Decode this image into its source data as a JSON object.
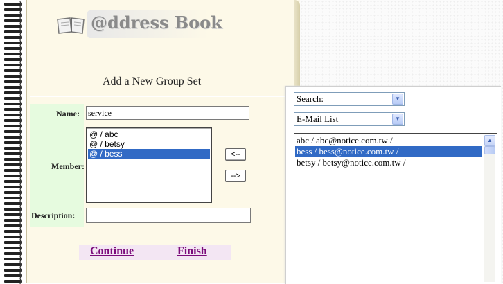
{
  "header": {
    "app_title": "@ddress Book",
    "icon": "book-icon"
  },
  "form": {
    "heading": "Add a New Group Set",
    "name_label": "Name:",
    "name_value": "service",
    "member_label": "Member:",
    "members": [
      "@ / abc",
      "@ / betsy",
      "@ / bess"
    ],
    "selected_member": "@ / bess",
    "remove_button": "<--",
    "add_button": "-->",
    "description_label": "Description:",
    "description_value": ""
  },
  "actions": {
    "continue_label": "Continue",
    "finish_label": "Finish"
  },
  "right_panel": {
    "search_select": "Search:",
    "list_select": "E-Mail List",
    "emails": [
      "abc / abc@notice.com.tw /",
      "bess / bess@notice.com.tw /",
      "betsy / betsy@notice.com.tw /"
    ],
    "selected_email": "bess / bess@notice.com.tw /"
  },
  "colors": {
    "selection": "#316ac5",
    "label_column": "#e6fbdf",
    "action_link": "#7b0c7b",
    "page": "#fdf9e8"
  }
}
